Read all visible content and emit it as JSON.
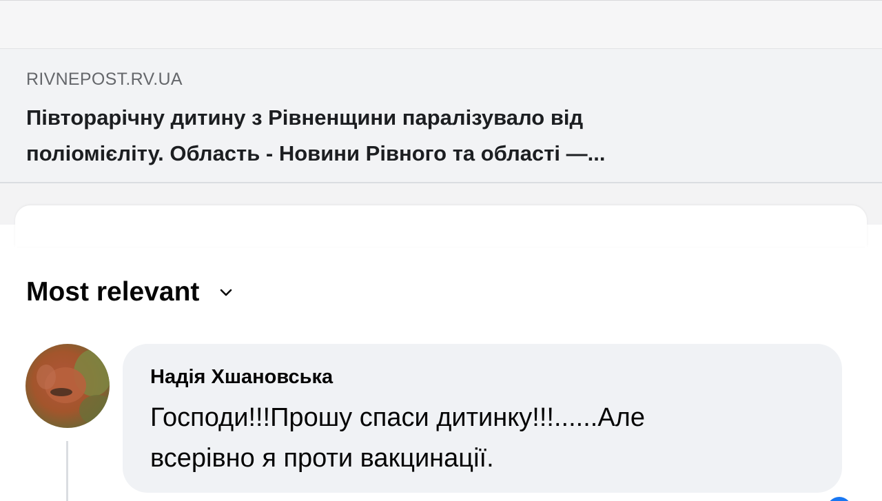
{
  "link_preview": {
    "domain": "RIVNEPOST.RV.UA",
    "title_line1": "Півторарічну дитину з Рівненщини паралізувало від",
    "title_line2": "поліомієліту. Область - Новини Рівного та області —..."
  },
  "comments_header": {
    "sort_label": "Most relevant",
    "sort_icon": "chevron-down-icon"
  },
  "comment": {
    "author": "Надія Хшановська",
    "text_line1": "Господи!!!Прошу спаси дитинку!!!......Але",
    "text_line2": "всерівно я проти вакцинації."
  },
  "colors": {
    "link_card_bg": "#f2f3f5",
    "bubble_bg": "#f0f2f5",
    "muted_text": "#65676b"
  }
}
